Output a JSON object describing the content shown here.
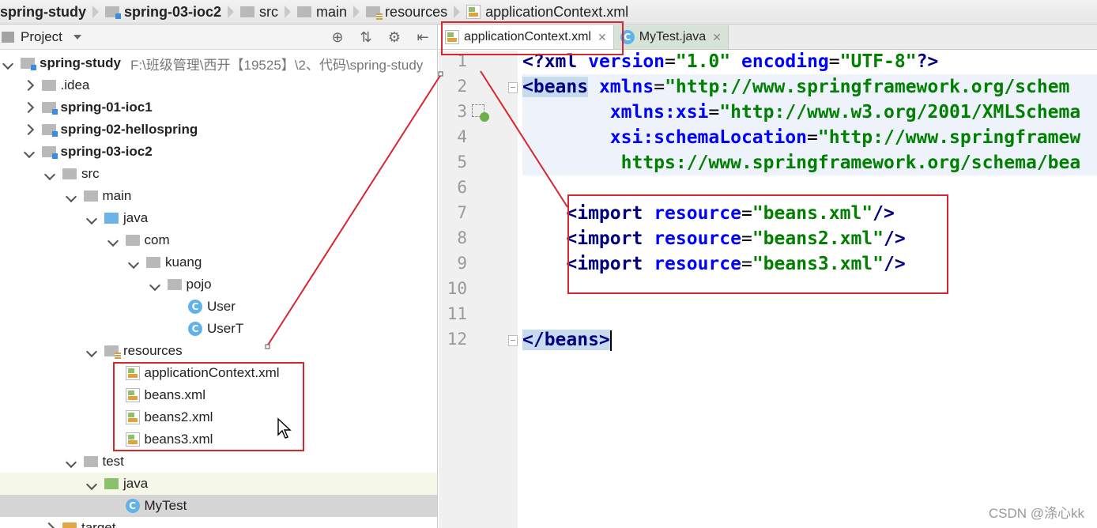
{
  "breadcrumb": [
    "spring-study",
    "spring-03-ioc2",
    "src",
    "main",
    "resources",
    "applicationContext.xml"
  ],
  "project_panel": {
    "title": "Project",
    "tools": [
      "⊕",
      "⇅",
      "⚙",
      "⇤"
    ],
    "tree": [
      {
        "label": "spring-study",
        "note": "F:\\班级管理\\西开【19525】\\2、代码\\spring-study",
        "icon": "module-folder-icon",
        "arrow": "down",
        "indent": 0,
        "bold": true
      },
      {
        "label": ".idea",
        "icon": "folder-icon",
        "arrow": "right",
        "indent": 1,
        "bold": false
      },
      {
        "label": "spring-01-ioc1",
        "icon": "module-folder-icon",
        "arrow": "right",
        "indent": 1,
        "bold": true
      },
      {
        "label": "spring-02-hellospring",
        "icon": "module-folder-icon",
        "arrow": "right",
        "indent": 1,
        "bold": true
      },
      {
        "label": "spring-03-ioc2",
        "icon": "module-folder-icon",
        "arrow": "down",
        "indent": 1,
        "bold": true
      },
      {
        "label": "src",
        "icon": "folder-icon",
        "arrow": "down",
        "indent": 2,
        "bold": false
      },
      {
        "label": "main",
        "icon": "folder-icon",
        "arrow": "down",
        "indent": 3,
        "bold": false
      },
      {
        "label": "java",
        "icon": "source-folder-icon",
        "arrow": "down",
        "indent": 4,
        "bold": false
      },
      {
        "label": "com",
        "icon": "package-icon",
        "arrow": "down",
        "indent": 5,
        "bold": false
      },
      {
        "label": "kuang",
        "icon": "package-icon",
        "arrow": "down",
        "indent": 6,
        "bold": false
      },
      {
        "label": "pojo",
        "icon": "package-icon",
        "arrow": "down",
        "indent": 7,
        "bold": false
      },
      {
        "label": "User",
        "icon": "class-icon",
        "arrow": "none",
        "indent": 8,
        "bold": false
      },
      {
        "label": "UserT",
        "icon": "class-icon",
        "arrow": "none",
        "indent": 8,
        "bold": false
      },
      {
        "label": "resources",
        "icon": "resources-folder-icon",
        "arrow": "down",
        "indent": 4,
        "bold": false
      },
      {
        "label": "applicationContext.xml",
        "icon": "xml-file-icon",
        "arrow": "none",
        "indent": 5,
        "bold": false
      },
      {
        "label": "beans.xml",
        "icon": "xml-file-icon",
        "arrow": "none",
        "indent": 5,
        "bold": false
      },
      {
        "label": "beans2.xml",
        "icon": "xml-file-icon",
        "arrow": "none",
        "indent": 5,
        "bold": false
      },
      {
        "label": "beans3.xml",
        "icon": "xml-file-icon",
        "arrow": "none",
        "indent": 5,
        "bold": false
      },
      {
        "label": "test",
        "icon": "folder-icon",
        "arrow": "down",
        "indent": 3,
        "bold": false
      },
      {
        "label": "java",
        "icon": "test-folder-icon",
        "arrow": "down",
        "indent": 4,
        "bold": false
      },
      {
        "label": "MyTest",
        "icon": "class-icon",
        "arrow": "none",
        "indent": 5,
        "bold": false
      },
      {
        "label": "target",
        "icon": "excluded-folder-icon",
        "arrow": "right",
        "indent": 2,
        "bold": false
      }
    ]
  },
  "editor": {
    "tabs": [
      {
        "label": "applicationContext.xml",
        "icon": "xml-file-icon",
        "active": true
      },
      {
        "label": "MyTest.java",
        "icon": "class-icon",
        "active": false
      }
    ],
    "line_numbers": [
      "1",
      "2",
      "3",
      "4",
      "5",
      "6",
      "7",
      "8",
      "9",
      "10",
      "11",
      "12"
    ],
    "code": {
      "l1": [
        "<?xml ",
        "version",
        "=",
        "\"1.0\"",
        " ",
        "encoding",
        "=",
        "\"UTF-8\"",
        "?>"
      ],
      "l2": [
        "<beans",
        " ",
        "xmlns",
        "=",
        "\"http://www.springframework.org/schem"
      ],
      "l3": [
        "xmlns:xsi",
        "=",
        "\"http://www.w3.org/2001/XMLSchema"
      ],
      "l4": [
        "xsi:schemaLocation",
        "=",
        "\"http://www.springframew"
      ],
      "l5": [
        "https://www.springframework.org/schema/bea"
      ],
      "l7": [
        "<import",
        " ",
        "resource",
        "=",
        "\"beans.xml\"",
        "/>"
      ],
      "l8": [
        "<import",
        " ",
        "resource",
        "=",
        "\"beans2.xml\"",
        "/>"
      ],
      "l9": [
        "<import",
        " ",
        "resource",
        "=",
        "\"beans3.xml\"",
        "/>"
      ],
      "l12": [
        "</beans>"
      ]
    }
  },
  "watermark": "CSDN @涤心kk",
  "colors": {
    "annotation_red": "#d7262f",
    "tag": "#000080",
    "attr": "#0000ff",
    "value": "#008000"
  }
}
